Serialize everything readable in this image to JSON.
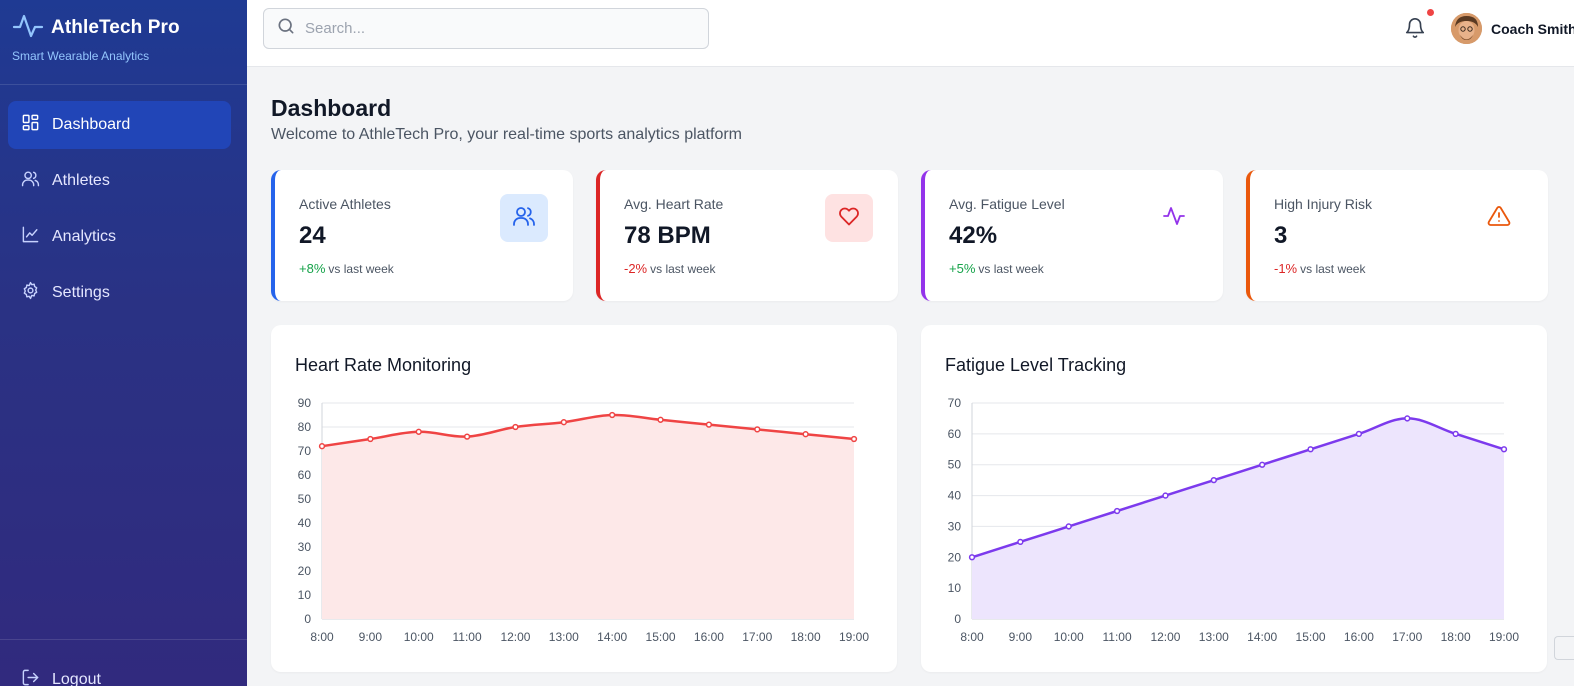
{
  "app": {
    "name": "AthleTech Pro",
    "tagline": "Smart Wearable Analytics",
    "logo_icon": "activity-icon"
  },
  "sidebar": {
    "items": [
      {
        "label": "Dashboard",
        "icon": "dashboard-icon",
        "active": true
      },
      {
        "label": "Athletes",
        "icon": "users-icon",
        "active": false
      },
      {
        "label": "Analytics",
        "icon": "chart-line-icon",
        "active": false
      },
      {
        "label": "Settings",
        "icon": "gear-icon",
        "active": false
      }
    ],
    "logout_label": "Logout"
  },
  "header": {
    "search_placeholder": "Search...",
    "user_name": "Coach Smith",
    "has_notifications": true
  },
  "page": {
    "title": "Dashboard",
    "subtitle": "Welcome to AthleTech Pro, your real-time sports analytics platform"
  },
  "stats": [
    {
      "label": "Active Athletes",
      "value": "24",
      "delta": "+8%",
      "delta_suffix": "vs last week",
      "accent": "#2563eb",
      "delta_color": "#16a34a",
      "icon": "users-icon",
      "icon_bg": "#dbeafe",
      "icon_color": "#2563eb"
    },
    {
      "label": "Avg. Heart Rate",
      "value": "78 BPM",
      "delta": "-2%",
      "delta_suffix": "vs last week",
      "accent": "#dc2626",
      "delta_color": "#dc2626",
      "icon": "heart-icon",
      "icon_bg": "#fee2e2",
      "icon_color": "#dc2626"
    },
    {
      "label": "Avg. Fatigue Level",
      "value": "42%",
      "delta": "+5%",
      "delta_suffix": "vs last week",
      "accent": "#9333ea",
      "delta_color": "#16a34a",
      "icon": "activity-icon",
      "icon_bg": "#ffffff",
      "icon_color": "#9333ea"
    },
    {
      "label": "High Injury Risk",
      "value": "3",
      "delta": "-1%",
      "delta_suffix": "vs last week",
      "accent": "#ea580c",
      "delta_color": "#dc2626",
      "icon": "warning-icon",
      "icon_bg": "#ffffff",
      "icon_color": "#ea580c"
    }
  ],
  "chart_data": [
    {
      "type": "area",
      "title": "Heart Rate Monitoring",
      "x": [
        "8:00",
        "9:00",
        "10:00",
        "11:00",
        "12:00",
        "13:00",
        "14:00",
        "15:00",
        "16:00",
        "17:00",
        "18:00",
        "19:00"
      ],
      "values": [
        72,
        75,
        78,
        76,
        80,
        82,
        85,
        83,
        81,
        79,
        77,
        75
      ],
      "ylim": [
        0,
        90
      ],
      "yticks": [
        0,
        10,
        20,
        30,
        40,
        50,
        60,
        70,
        80,
        90
      ],
      "grid": true,
      "line_color": "#ef4444",
      "fill_color": "#fde8e8"
    },
    {
      "type": "area",
      "title": "Fatigue Level Tracking",
      "x": [
        "8:00",
        "9:00",
        "10:00",
        "11:00",
        "12:00",
        "13:00",
        "14:00",
        "15:00",
        "16:00",
        "17:00",
        "18:00",
        "19:00"
      ],
      "values": [
        20,
        25,
        30,
        35,
        40,
        45,
        50,
        55,
        60,
        65,
        60,
        55
      ],
      "ylim": [
        0,
        70
      ],
      "yticks": [
        0,
        10,
        20,
        30,
        40,
        50,
        60,
        70
      ],
      "grid": true,
      "line_color": "#7c3aed",
      "fill_color": "#ede5fd"
    }
  ]
}
